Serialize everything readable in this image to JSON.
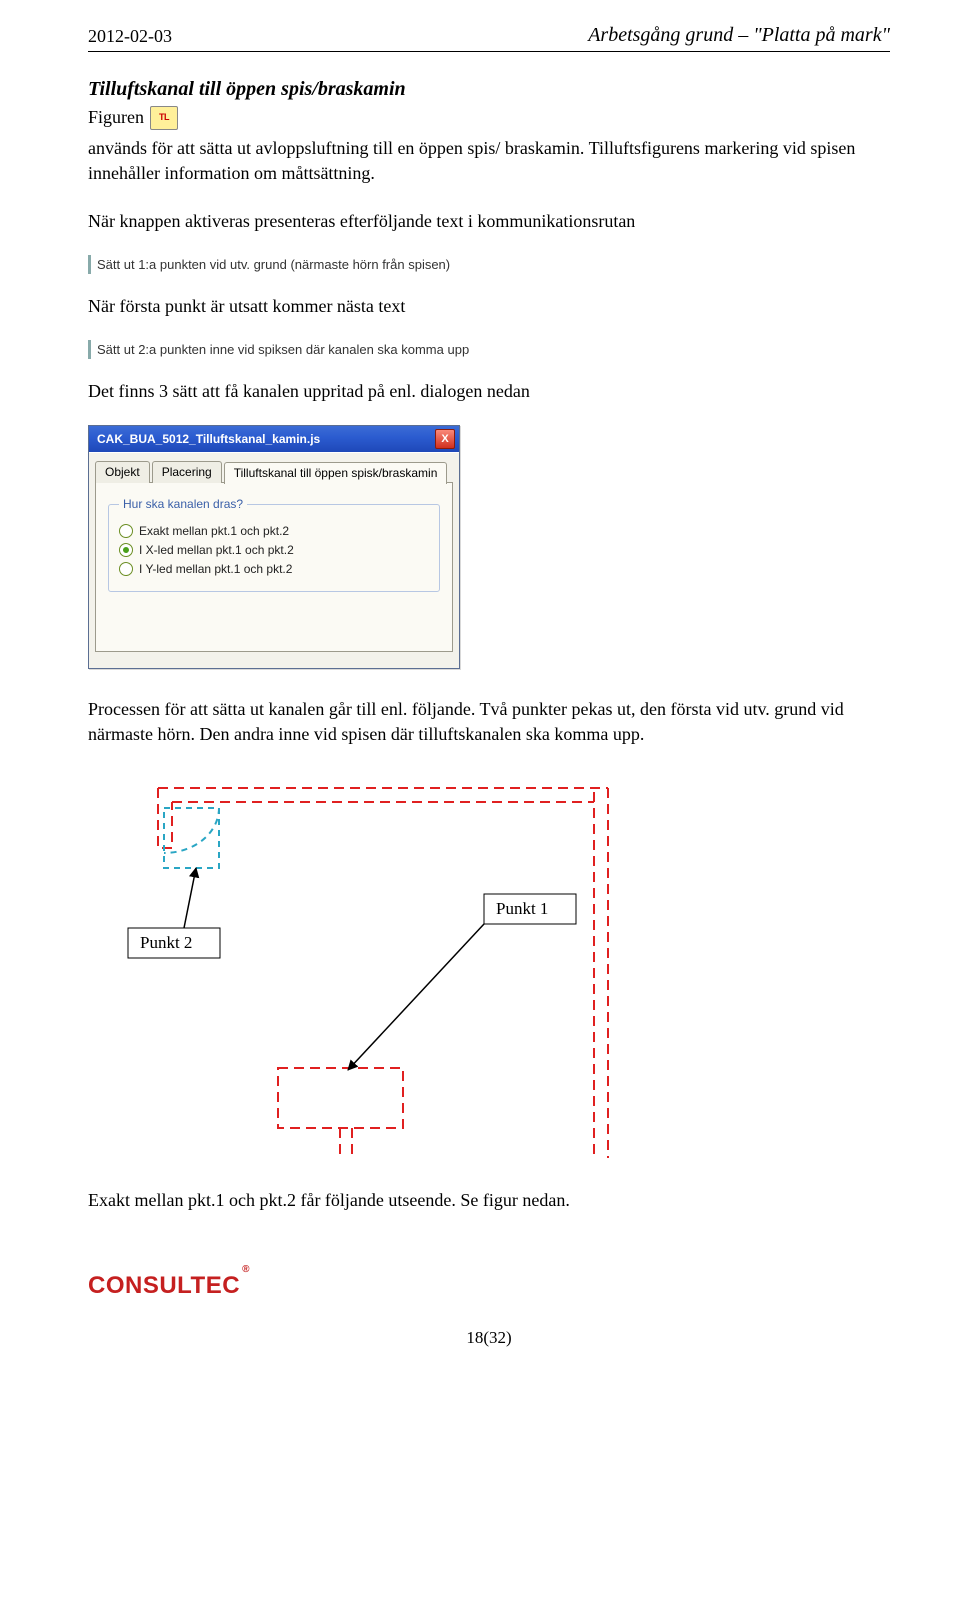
{
  "header": {
    "date": "2012-02-03",
    "doc_title": "Arbetsgång grund – \"Platta på mark\""
  },
  "section_title": "Tilluftskanal till öppen spis/braskamin",
  "intro": {
    "before_icon": "Figuren",
    "icon_label": "TL",
    "after_icon": " används för att sätta ut avloppsluftning till en öppen spis/ braskamin. Tilluftsfigurens markering vid spisen innehåller information om måttsättning."
  },
  "p1": "När knappen aktiveras presenteras efterföljande text i kommunikationsrutan",
  "status1": "Sätt ut 1:a punkten vid utv. grund (närmaste hörn från spisen)",
  "p2": "När första punkt är utsatt kommer nästa text",
  "status2": "Sätt ut 2:a punkten inne vid spiksen där kanalen ska komma upp",
  "p3": "Det finns 3 sätt att få kanalen uppritad på enl. dialogen nedan",
  "dialog": {
    "title": "CAK_BUA_5012_Tilluftskanal_kamin.js",
    "close_text": "X",
    "tabs": {
      "objekt": "Objekt",
      "placering": "Placering",
      "main": "Tilluftskanal till öppen spisk/braskamin"
    },
    "legend": "Hur ska kanalen dras?",
    "opt1": "Exakt mellan pkt.1 och pkt.2",
    "opt2": "I X-led mellan pkt.1 och pkt.2",
    "opt3": "I Y-led mellan pkt.1 och pkt.2"
  },
  "p4": "Processen för att sätta ut kanalen går till enl. följande. Två punkter pekas ut, den första vid utv. grund vid närmaste hörn. Den andra inne vid spisen där tilluftskanalen ska komma upp.",
  "diagram": {
    "punkt1": "Punkt 1",
    "punkt2": "Punkt 2"
  },
  "p5": "Exakt mellan pkt.1 och pkt.2 får följande utseende. Se figur nedan.",
  "footer": {
    "logo": "CONSULTEC",
    "page": "18(32)"
  }
}
